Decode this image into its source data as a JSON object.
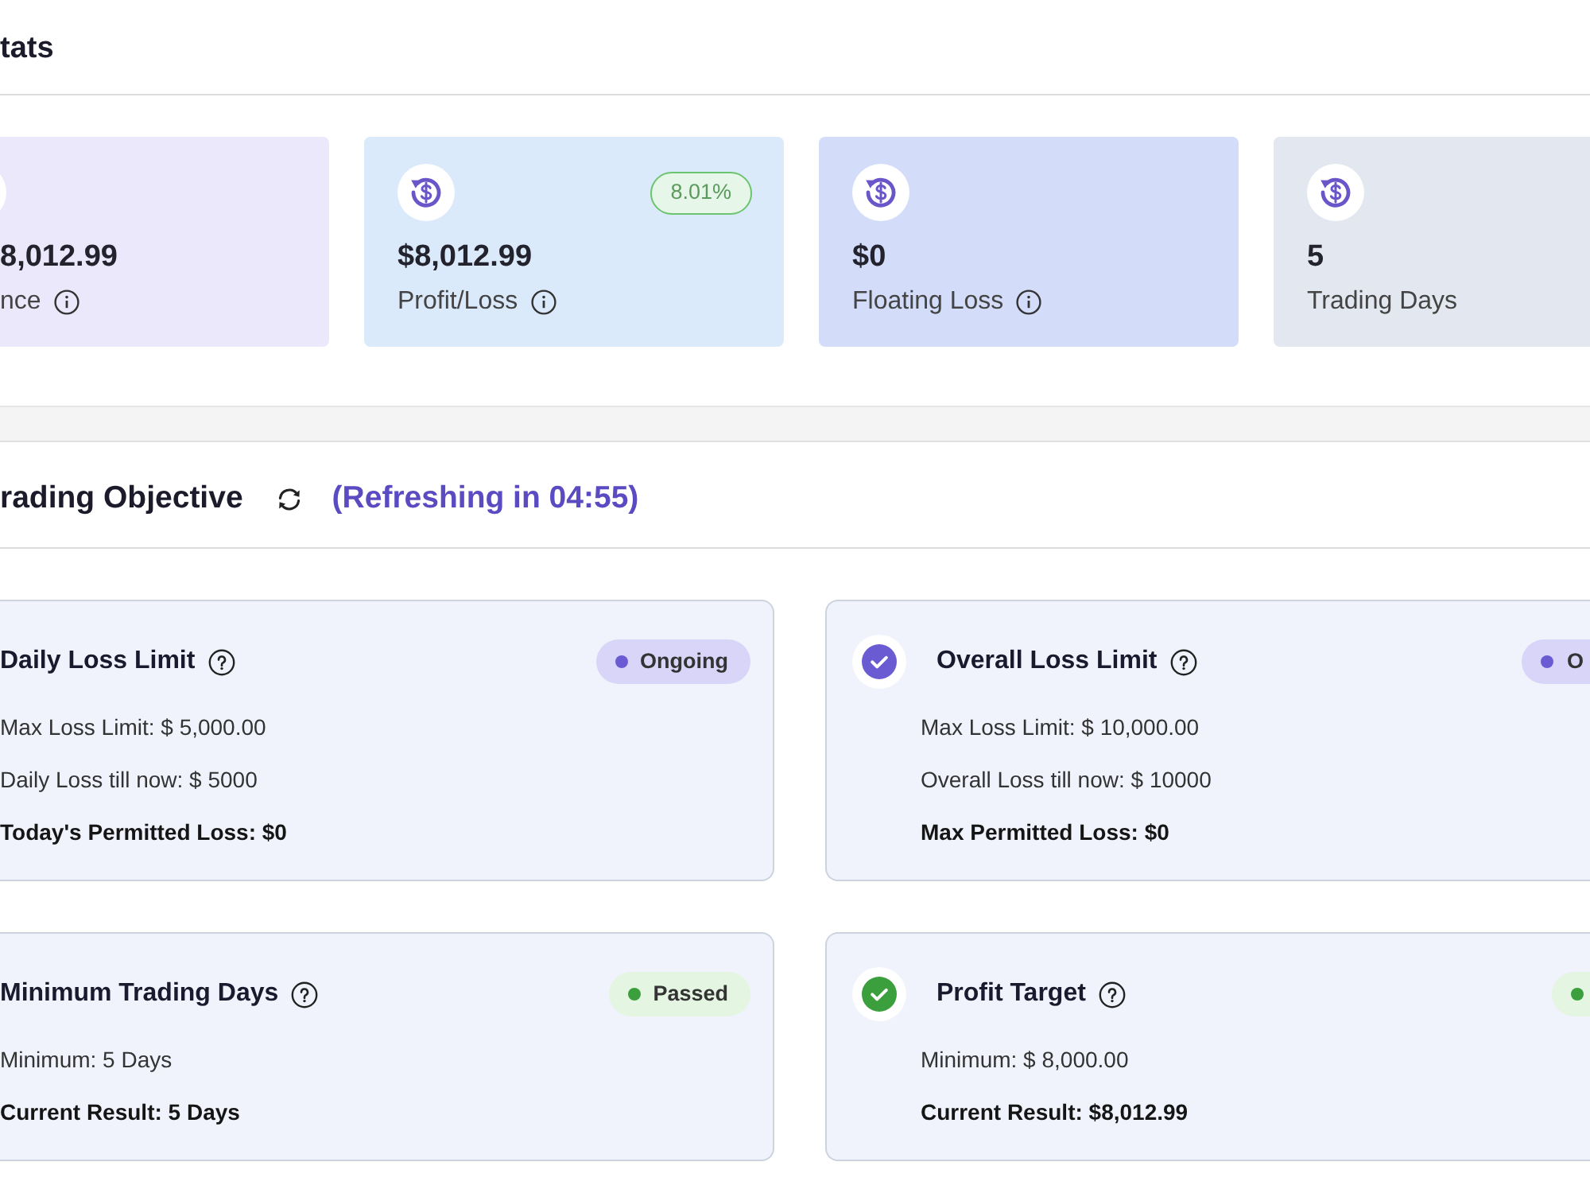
{
  "stats": {
    "title": "tats",
    "cards": [
      {
        "value": "8,012.99",
        "label": "nce",
        "info": true,
        "color": "#ebe8fb"
      },
      {
        "value": "$8,012.99",
        "label": "Profit/Loss",
        "info": true,
        "color": "#dbeafa",
        "change": "8.01%"
      },
      {
        "value": "$0",
        "label": "Floating Loss",
        "info": true,
        "color": "#d3ddfa"
      },
      {
        "value": "5",
        "label": "Trading Days",
        "info": false,
        "color": "#e3e8f0"
      }
    ]
  },
  "objectives": {
    "title": "rading Objective",
    "refresh_note": "(Refreshing in 04:55)",
    "items": [
      {
        "title": "Daily Loss Limit",
        "check_icon": false,
        "passed": false,
        "badge": "Ongoing",
        "lines": [
          {
            "text": "Max Loss Limit: $ 5,000.00",
            "kind": "detail"
          },
          {
            "text": "Daily Loss till now: $ 5000",
            "kind": "detail"
          },
          {
            "text": "Today's Permitted Loss: $0",
            "kind": "total"
          }
        ]
      },
      {
        "title": "Overall Loss Limit",
        "check_icon": true,
        "passed": false,
        "badge": "O",
        "lines": [
          {
            "text": "Max Loss Limit: $ 10,000.00",
            "kind": "detail"
          },
          {
            "text": "Overall Loss till now: $ 10000",
            "kind": "detail"
          },
          {
            "text": "Max Permitted Loss: $0",
            "kind": "total"
          }
        ]
      },
      {
        "title": "Minimum Trading Days",
        "check_icon": false,
        "passed": true,
        "badge": "Passed",
        "lines": [
          {
            "text": "Minimum: 5 Days",
            "kind": "detail"
          },
          {
            "text": "Current Result: 5 Days",
            "kind": "total"
          }
        ]
      },
      {
        "title": "Profit Target",
        "check_icon": true,
        "passed": true,
        "lines": [
          {
            "text": "Minimum: $ 8,000.00",
            "kind": "detail"
          },
          {
            "text": "Current Result: $8,012.99",
            "kind": "total"
          }
        ]
      }
    ]
  }
}
